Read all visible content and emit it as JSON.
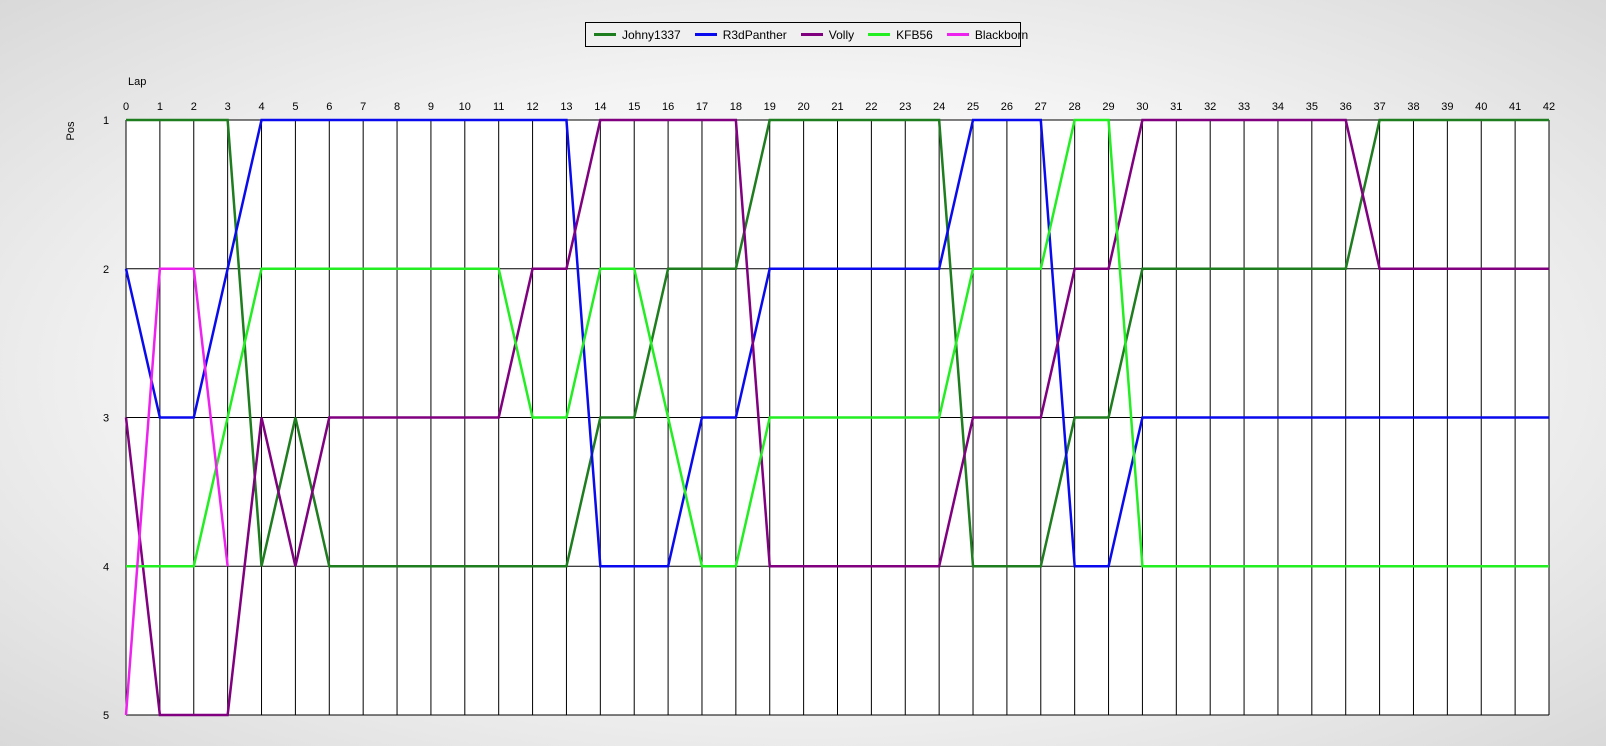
{
  "chart_data": {
    "type": "line",
    "xlabel": "Lap",
    "ylabel": "Pos",
    "x": [
      0,
      1,
      2,
      3,
      4,
      5,
      6,
      7,
      8,
      9,
      10,
      11,
      12,
      13,
      14,
      15,
      16,
      17,
      18,
      19,
      20,
      21,
      22,
      23,
      24,
      25,
      26,
      27,
      28,
      29,
      30,
      31,
      32,
      33,
      34,
      35,
      36,
      37,
      38,
      39,
      40,
      41,
      42
    ],
    "ylim": [
      1,
      5
    ],
    "yticks": [
      1,
      2,
      3,
      4,
      5
    ],
    "y_inverted": true,
    "grid": true,
    "legend": "top-center",
    "series": [
      {
        "name": "Johny1337",
        "color": "#1e7d1e",
        "values": [
          1,
          1,
          1,
          1,
          4,
          3,
          4,
          4,
          4,
          4,
          4,
          4,
          4,
          4,
          3,
          3,
          2,
          2,
          2,
          1,
          1,
          1,
          1,
          1,
          1,
          4,
          4,
          4,
          3,
          3,
          2,
          2,
          2,
          2,
          2,
          2,
          2,
          1,
          1,
          1,
          1,
          1,
          1
        ]
      },
      {
        "name": "R3dPanther",
        "color": "#0a0aee",
        "values": [
          2,
          3,
          3,
          2,
          1,
          1,
          1,
          1,
          1,
          1,
          1,
          1,
          1,
          1,
          4,
          4,
          4,
          3,
          3,
          2,
          2,
          2,
          2,
          2,
          2,
          1,
          1,
          1,
          4,
          4,
          3,
          3,
          3,
          3,
          3,
          3,
          3,
          3,
          3,
          3,
          3,
          3,
          3
        ]
      },
      {
        "name": "Volly",
        "color": "#800080",
        "values": [
          3,
          5,
          5,
          5,
          3,
          4,
          3,
          3,
          3,
          3,
          3,
          3,
          2,
          2,
          1,
          1,
          1,
          1,
          1,
          4,
          4,
          4,
          4,
          4,
          4,
          3,
          3,
          3,
          2,
          2,
          1,
          1,
          1,
          1,
          1,
          1,
          1,
          2,
          2,
          2,
          2,
          2,
          2
        ]
      },
      {
        "name": "KFB56",
        "color": "#22ee22",
        "values": [
          4,
          4,
          4,
          3,
          2,
          2,
          2,
          2,
          2,
          2,
          2,
          2,
          3,
          3,
          2,
          2,
          3,
          4,
          4,
          3,
          3,
          3,
          3,
          3,
          3,
          2,
          2,
          2,
          1,
          1,
          4,
          4,
          4,
          4,
          4,
          4,
          4,
          4,
          4,
          4,
          4,
          4,
          4
        ]
      },
      {
        "name": "Blackborn",
        "color": "#ee22ee",
        "values": [
          5,
          2,
          2,
          4
        ]
      }
    ]
  }
}
